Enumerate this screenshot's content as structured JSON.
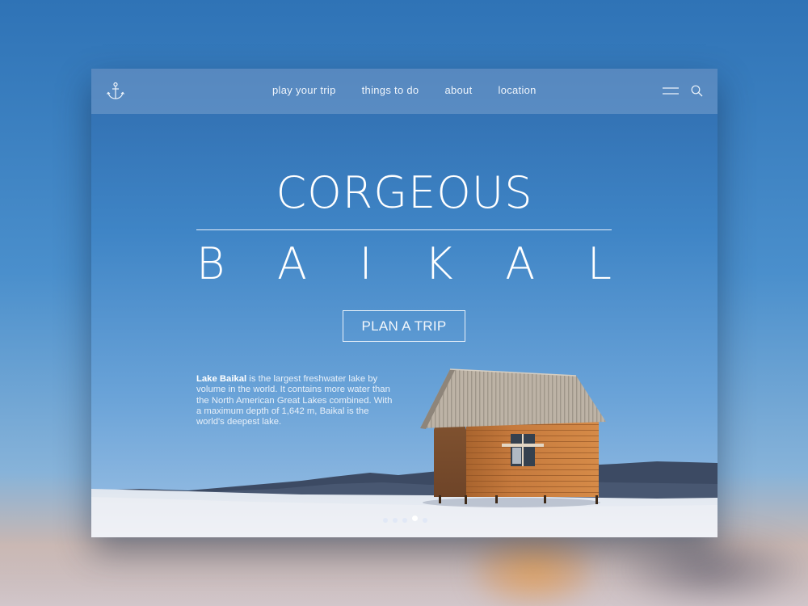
{
  "nav": {
    "logo_icon": "anchor-icon",
    "links": [
      {
        "label": "play your trip"
      },
      {
        "label": "things to do"
      },
      {
        "label": "about"
      },
      {
        "label": "location"
      }
    ],
    "menu_icon": "hamburger-menu-icon",
    "search_icon": "search-icon"
  },
  "hero": {
    "title_line1": "CORGEOUS",
    "title_line2_letters": [
      "B",
      "A",
      "I",
      "K",
      "A",
      "L"
    ],
    "cta_label": "PLAN A TRIP"
  },
  "description": {
    "highlight": "Lake Baikal",
    "body": " is the largest freshwater lake by volume in the world. It contains more water than the North American Great Lakes combined. With a maximum depth of 1,642 m, Baikal is the world's deepest lake."
  },
  "carousel": {
    "slide_count": 5,
    "active_index": 3
  },
  "colors": {
    "sky_top": "#2f6cae",
    "sky_bottom": "#9dc1e4",
    "wood": "#c8783a",
    "roof": "#b9b0a3",
    "snow": "#eef1f6"
  }
}
